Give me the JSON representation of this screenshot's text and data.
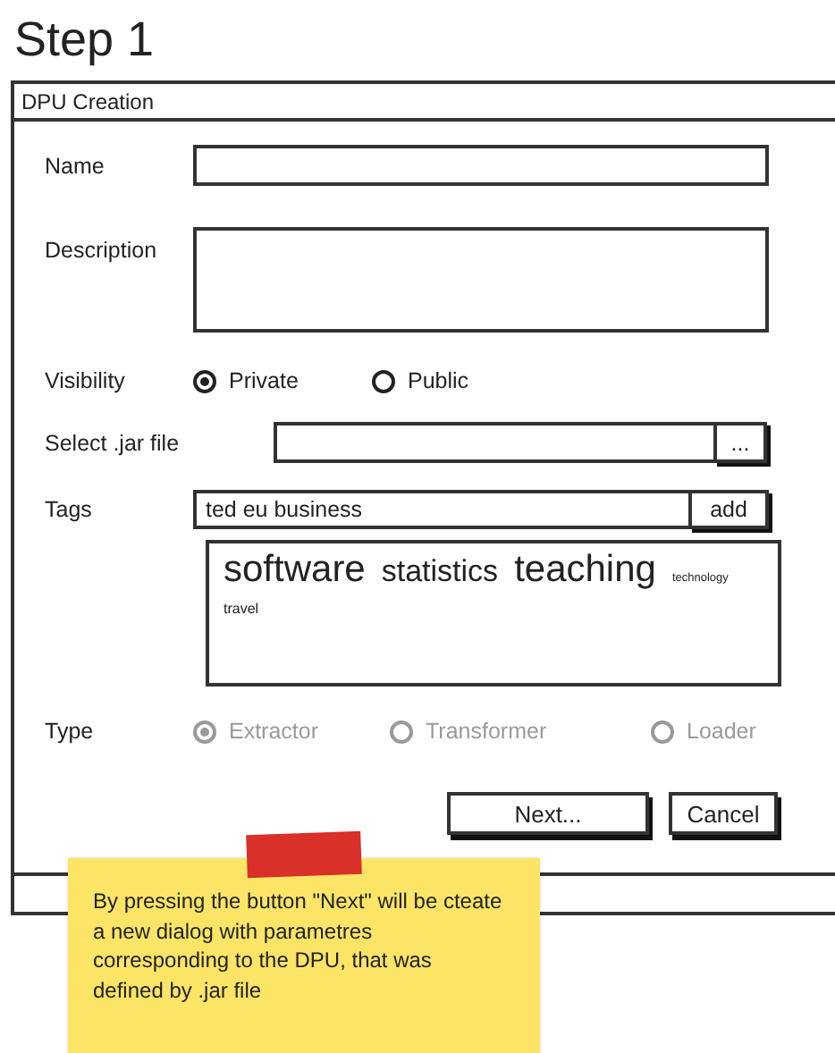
{
  "page_title": "Step 1",
  "window": {
    "title": "DPU Creation"
  },
  "form": {
    "name": {
      "label": "Name"
    },
    "description": {
      "label": "Description"
    },
    "visibility": {
      "label": "Visibility",
      "disabled": false,
      "options": [
        {
          "label": "Private",
          "selected": true
        },
        {
          "label": "Public",
          "selected": false
        }
      ]
    },
    "jar_file": {
      "label": "Select .jar file",
      "button": "..."
    },
    "tags": {
      "label": "Tags",
      "value": "ted eu business",
      "button": "add",
      "cloud": [
        {
          "text": "software",
          "kind": "large"
        },
        {
          "text": "statistics",
          "kind": "medium"
        },
        {
          "text": "teaching",
          "kind": "large"
        },
        {
          "text": "technology",
          "kind": "tiny"
        },
        {
          "text": "travel",
          "kind": "small"
        }
      ]
    },
    "type": {
      "label": "Type",
      "disabled": true,
      "options": [
        {
          "label": "Extractor",
          "selected": true
        },
        {
          "label": "Transformer",
          "selected": false
        },
        {
          "label": "Loader",
          "selected": false
        }
      ]
    }
  },
  "buttons": [
    {
      "label": "Next...",
      "kind": "wide"
    },
    {
      "label": "Cancel",
      "kind": "narrow"
    }
  ],
  "note": {
    "text": "By pressing the button \"Next\" will be cteate a new dialog with parametres corresponding to the DPU, that was defined by .jar file"
  }
}
